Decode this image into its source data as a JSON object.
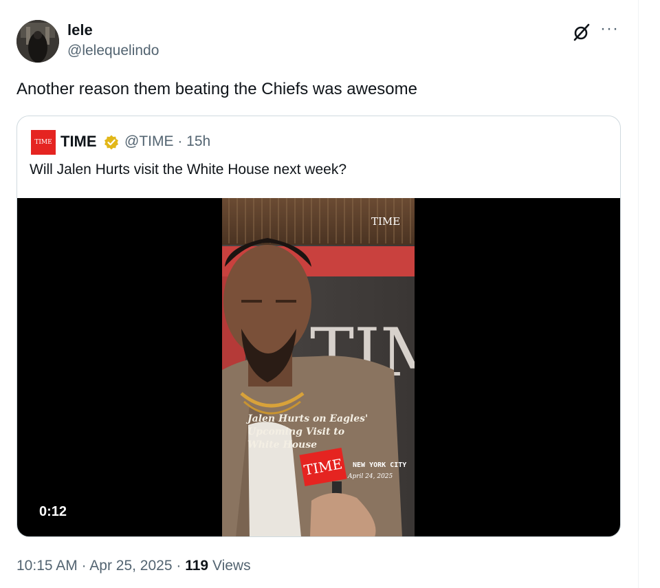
{
  "tweet": {
    "display_name": "lele",
    "handle": "@lelequelindo",
    "text": "Another reason them beating the Chiefs was awesome",
    "time": "10:15 AM",
    "date": "Apr 25, 2025",
    "views_count": "119",
    "views_label": "Views"
  },
  "quoted": {
    "logo_text": "TIME",
    "name": "TIME",
    "handle_time": "@TIME · 15h",
    "text": "Will Jalen Hurts visit the White House next week?",
    "video": {
      "duration": "0:12",
      "overlay_logo": "TIME",
      "caption_lines": [
        "Jalen Hurts on Eagles'",
        "Upcoming Visit to",
        "White House"
      ],
      "mic_logo": "TIME",
      "location": "NEW YORK CITY",
      "event_date": "April 24, 2025",
      "backdrop_text": "TIM"
    }
  },
  "icons": {
    "grok": "grok-icon",
    "more": "more-icon",
    "verified": "verified-badge-icon"
  },
  "colors": {
    "secondary_text": "#536471",
    "primary_text": "#0f1419",
    "border": "#cfd9de",
    "time_red": "#e52421",
    "verified_gold": "#e2b719"
  }
}
